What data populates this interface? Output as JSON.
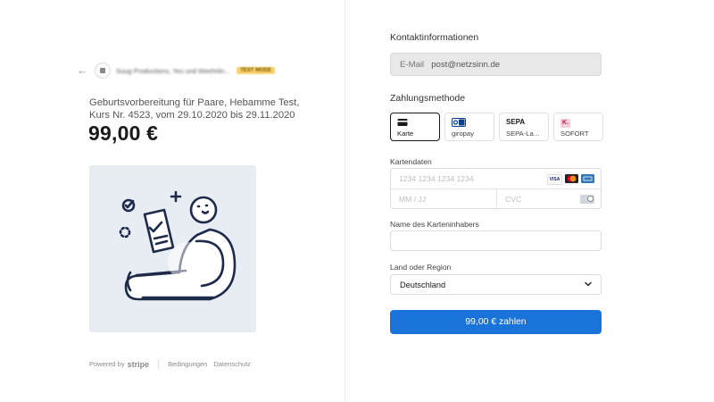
{
  "header": {
    "merchant_name": "Suug Productions, Yes und Weehrlin…",
    "test_badge": "TEST MODE"
  },
  "product": {
    "description": "Geburtsvorbereitung für Paare, Hebamme Test, Kurs Nr. 4523, vom 29.10.2020 bis 29.11.2020",
    "price": "99,00 €"
  },
  "footer": {
    "powered_by": "Powered by",
    "brand": "stripe",
    "terms": "Bedingungen",
    "privacy": "Datenschutz"
  },
  "contact": {
    "heading": "Kontaktinformationen",
    "email_label": "E-Mail",
    "email_value": "post@netzsinn.de"
  },
  "payment": {
    "heading": "Zahlungsmethode",
    "methods": [
      {
        "label": "Karte",
        "selected": true,
        "icon": "card-icon"
      },
      {
        "label": "giropay",
        "selected": false,
        "icon": "giropay-icon"
      },
      {
        "label": "SEPA-La…",
        "selected": false,
        "icon": "sepa-icon",
        "icon_text": "SEPA"
      },
      {
        "label": "SOFORT",
        "selected": false,
        "icon": "sofort-icon",
        "icon_text": "K."
      }
    ]
  },
  "card": {
    "label": "Kartendaten",
    "number_placeholder": "1234 1234 1234 1234",
    "expiry_placeholder": "MM / JJ",
    "cvc_placeholder": "CVC",
    "brands": [
      {
        "name": "VISA",
        "color": "#1a1f71"
      },
      {
        "name": "MC",
        "color": "#eb001b"
      },
      {
        "name": "AMEX",
        "color": "#2e77bb"
      }
    ]
  },
  "cardholder": {
    "label": "Name des Karteninhabers",
    "value": ""
  },
  "country": {
    "label": "Land oder Region",
    "value": "Deutschland"
  },
  "submit": {
    "label": "99,00 € zahlen",
    "color": "#1a73d9"
  }
}
